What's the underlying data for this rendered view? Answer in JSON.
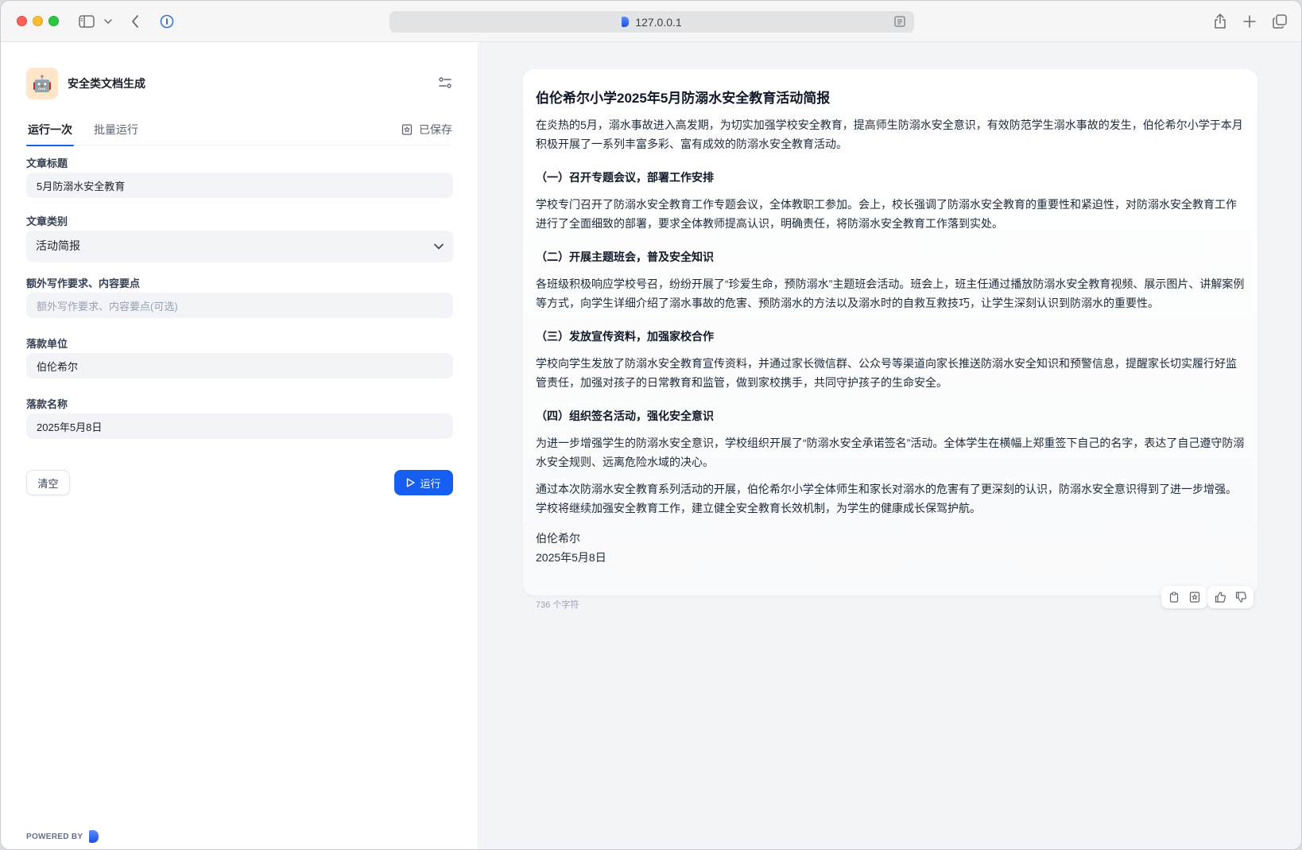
{
  "browser": {
    "url": "127.0.0.1"
  },
  "app": {
    "title": "安全类文档生成",
    "avatar_emoji": "🤖"
  },
  "tabs": [
    {
      "label": "运行一次",
      "active": true
    },
    {
      "label": "批量运行",
      "active": false
    }
  ],
  "saved_label": "已保存",
  "form": {
    "title_label": "文章标题",
    "title_value": "5月防溺水安全教育",
    "category_label": "文章类别",
    "category_value": "活动简报",
    "extra_label": "额外写作要求、内容要点",
    "extra_placeholder": "额外写作要求、内容要点(可选)",
    "unit_label": "落款单位",
    "unit_value": "伯伦希尔",
    "name_label": "落款名称",
    "name_value": "2025年5月8日"
  },
  "buttons": {
    "clear": "清空",
    "run": "运行"
  },
  "footer": {
    "powered_by": "POWERED BY"
  },
  "result": {
    "title": "伯伦希尔小学2025年5月防溺水安全教育活动简报",
    "intro": "在炎热的5月，溺水事故进入高发期，为切实加强学校安全教育，提高师生防溺水安全意识，有效防范学生溺水事故的发生，伯伦希尔小学于本月积极开展了一系列丰富多彩、富有成效的防溺水安全教育活动。",
    "sections": [
      {
        "heading": "（一）召开专题会议，部署工作安排",
        "body": "学校专门召开了防溺水安全教育工作专题会议，全体教职工参加。会上，校长强调了防溺水安全教育的重要性和紧迫性，对防溺水安全教育工作进行了全面细致的部署，要求全体教师提高认识，明确责任，将防溺水安全教育工作落到实处。"
      },
      {
        "heading": "（二）开展主题班会，普及安全知识",
        "body": "各班级积极响应学校号召，纷纷开展了“珍爱生命，预防溺水”主题班会活动。班会上，班主任通过播放防溺水安全教育视频、展示图片、讲解案例等方式，向学生详细介绍了溺水事故的危害、预防溺水的方法以及溺水时的自救互救技巧，让学生深刻认识到防溺水的重要性。"
      },
      {
        "heading": "（三）发放宣传资料，加强家校合作",
        "body": "学校向学生发放了防溺水安全教育宣传资料，并通过家长微信群、公众号等渠道向家长推送防溺水安全知识和预警信息，提醒家长切实履行好监管责任，加强对孩子的日常教育和监管，做到家校携手，共同守护孩子的生命安全。"
      },
      {
        "heading": "（四）组织签名活动，强化安全意识",
        "body": "为进一步增强学生的防溺水安全意识，学校组织开展了“防溺水安全承诺签名”活动。全体学生在横幅上郑重签下自己的名字，表达了自己遵守防溺水安全规则、远离危险水域的决心。"
      }
    ],
    "conclusion": "通过本次防溺水安全教育系列活动的开展，伯伦希尔小学全体师生和家长对溺水的危害有了更深刻的认识，防溺水安全意识得到了进一步增强。学校将继续加强安全教育工作，建立健全安全教育长效机制，为学生的健康成长保驾护航。",
    "signature_unit": "伯伦希尔",
    "signature_date": "2025年5月8日",
    "char_count": "736 个字符"
  },
  "colors": {
    "accent": "#155eef",
    "panel_bg": "#f2f4f7"
  }
}
